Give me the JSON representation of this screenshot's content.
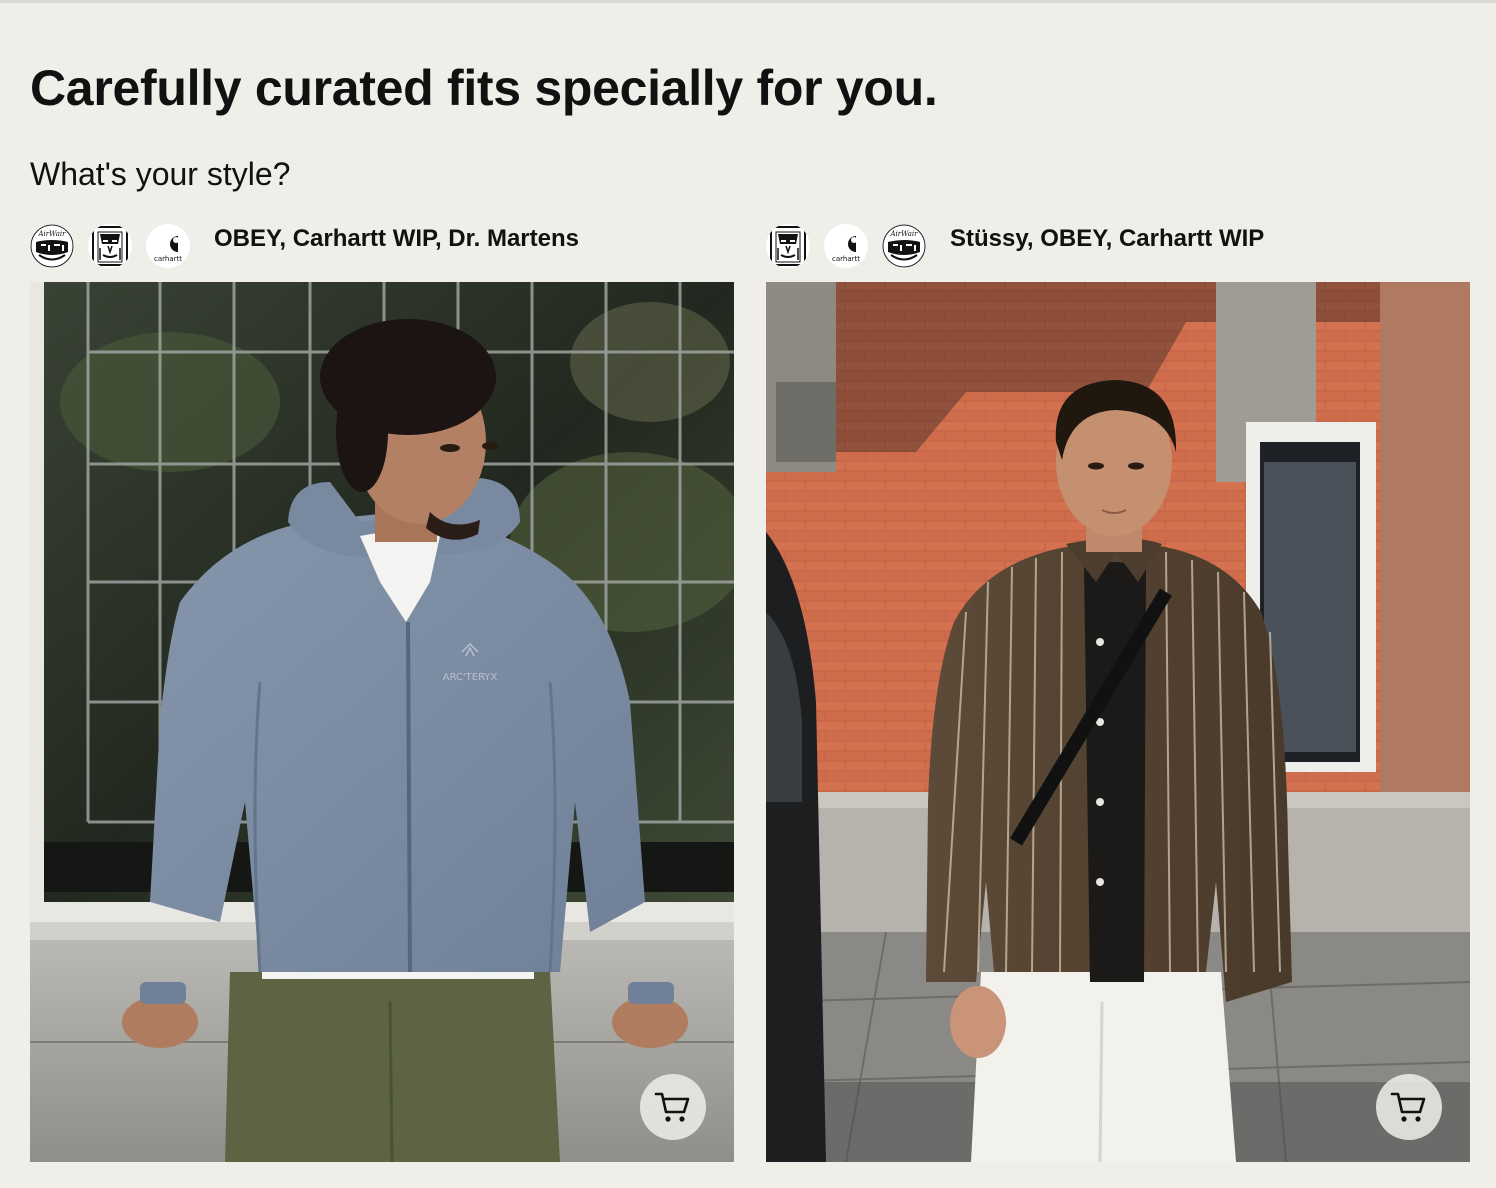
{
  "header": {
    "title": "Carefully curated fits specially for you.",
    "subtitle": "What's your style?"
  },
  "outfits": [
    {
      "brands_label": "OBEY, Carhartt WIP, Dr. Martens",
      "logos": [
        {
          "icon": "dr-martens-logo",
          "text": "AirWair"
        },
        {
          "icon": "obey-logo"
        },
        {
          "icon": "carhartt-logo",
          "text": "carhartt"
        }
      ],
      "photo": "man-in-blue-arcteryx-jacket-leaning-on-window-ledge",
      "jacket_text": "ARC'TERYX",
      "cart_icon": "shopping-cart-icon"
    },
    {
      "brands_label": "Stüssy, OBEY, Carhartt WIP",
      "logos": [
        {
          "icon": "obey-logo"
        },
        {
          "icon": "carhartt-logo",
          "text": "carhartt"
        },
        {
          "icon": "dr-martens-logo",
          "text": "AirWair"
        }
      ],
      "photo": "man-in-striped-shirt-before-brick-building",
      "cart_icon": "shopping-cart-icon"
    }
  ],
  "colors": {
    "background": "#f0eee9",
    "text": "#111111"
  }
}
